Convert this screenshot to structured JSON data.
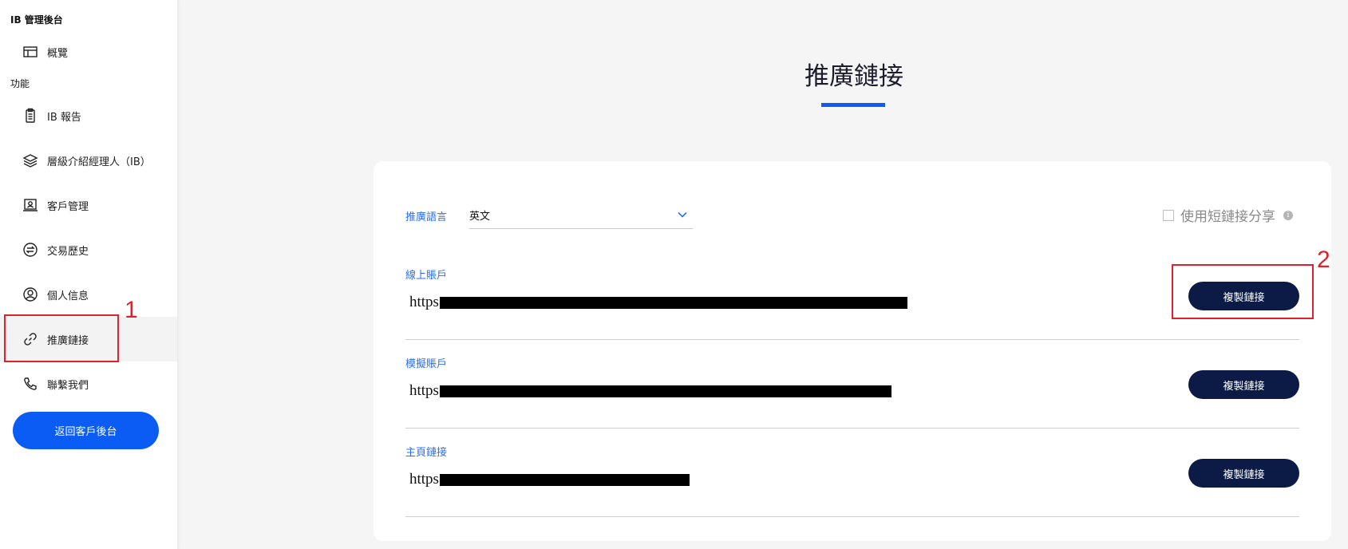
{
  "sidebar": {
    "app_title": "IB 管理後台",
    "section_functions": "功能",
    "items": [
      {
        "label": "概覽",
        "icon": "layout-icon"
      },
      {
        "label": "IB 報告",
        "icon": "clipboard-icon"
      },
      {
        "label": "層級介紹經理人（IB）",
        "icon": "layers-icon"
      },
      {
        "label": "客戶管理",
        "icon": "client-icon"
      },
      {
        "label": "交易歷史",
        "icon": "exchange-icon"
      },
      {
        "label": "個人信息",
        "icon": "user-icon"
      },
      {
        "label": "推廣鏈接",
        "icon": "link-icon"
      },
      {
        "label": "聯繫我們",
        "icon": "phone-icon"
      }
    ],
    "back_button": "返回客戶後台"
  },
  "main": {
    "title": "推廣鏈接",
    "language_label": "推廣語言",
    "language_value": "英文",
    "short_link_label": "使用短鏈接分享",
    "info_glyph": "i",
    "links": [
      {
        "label": "線上賬戶",
        "url_prefix": "https",
        "button": "複製鏈接"
      },
      {
        "label": "模擬賬戶",
        "url_prefix": "https",
        "button": "複製鏈接"
      },
      {
        "label": "主頁鏈接",
        "url_prefix": "https",
        "button": "複製鏈接"
      }
    ]
  },
  "annotations": [
    "1",
    "2"
  ],
  "colors": {
    "accent": "#0a5cf5",
    "button_dark": "#0b1b45",
    "label_blue": "#2a6ff5",
    "annotation_red": "#e0202a"
  }
}
